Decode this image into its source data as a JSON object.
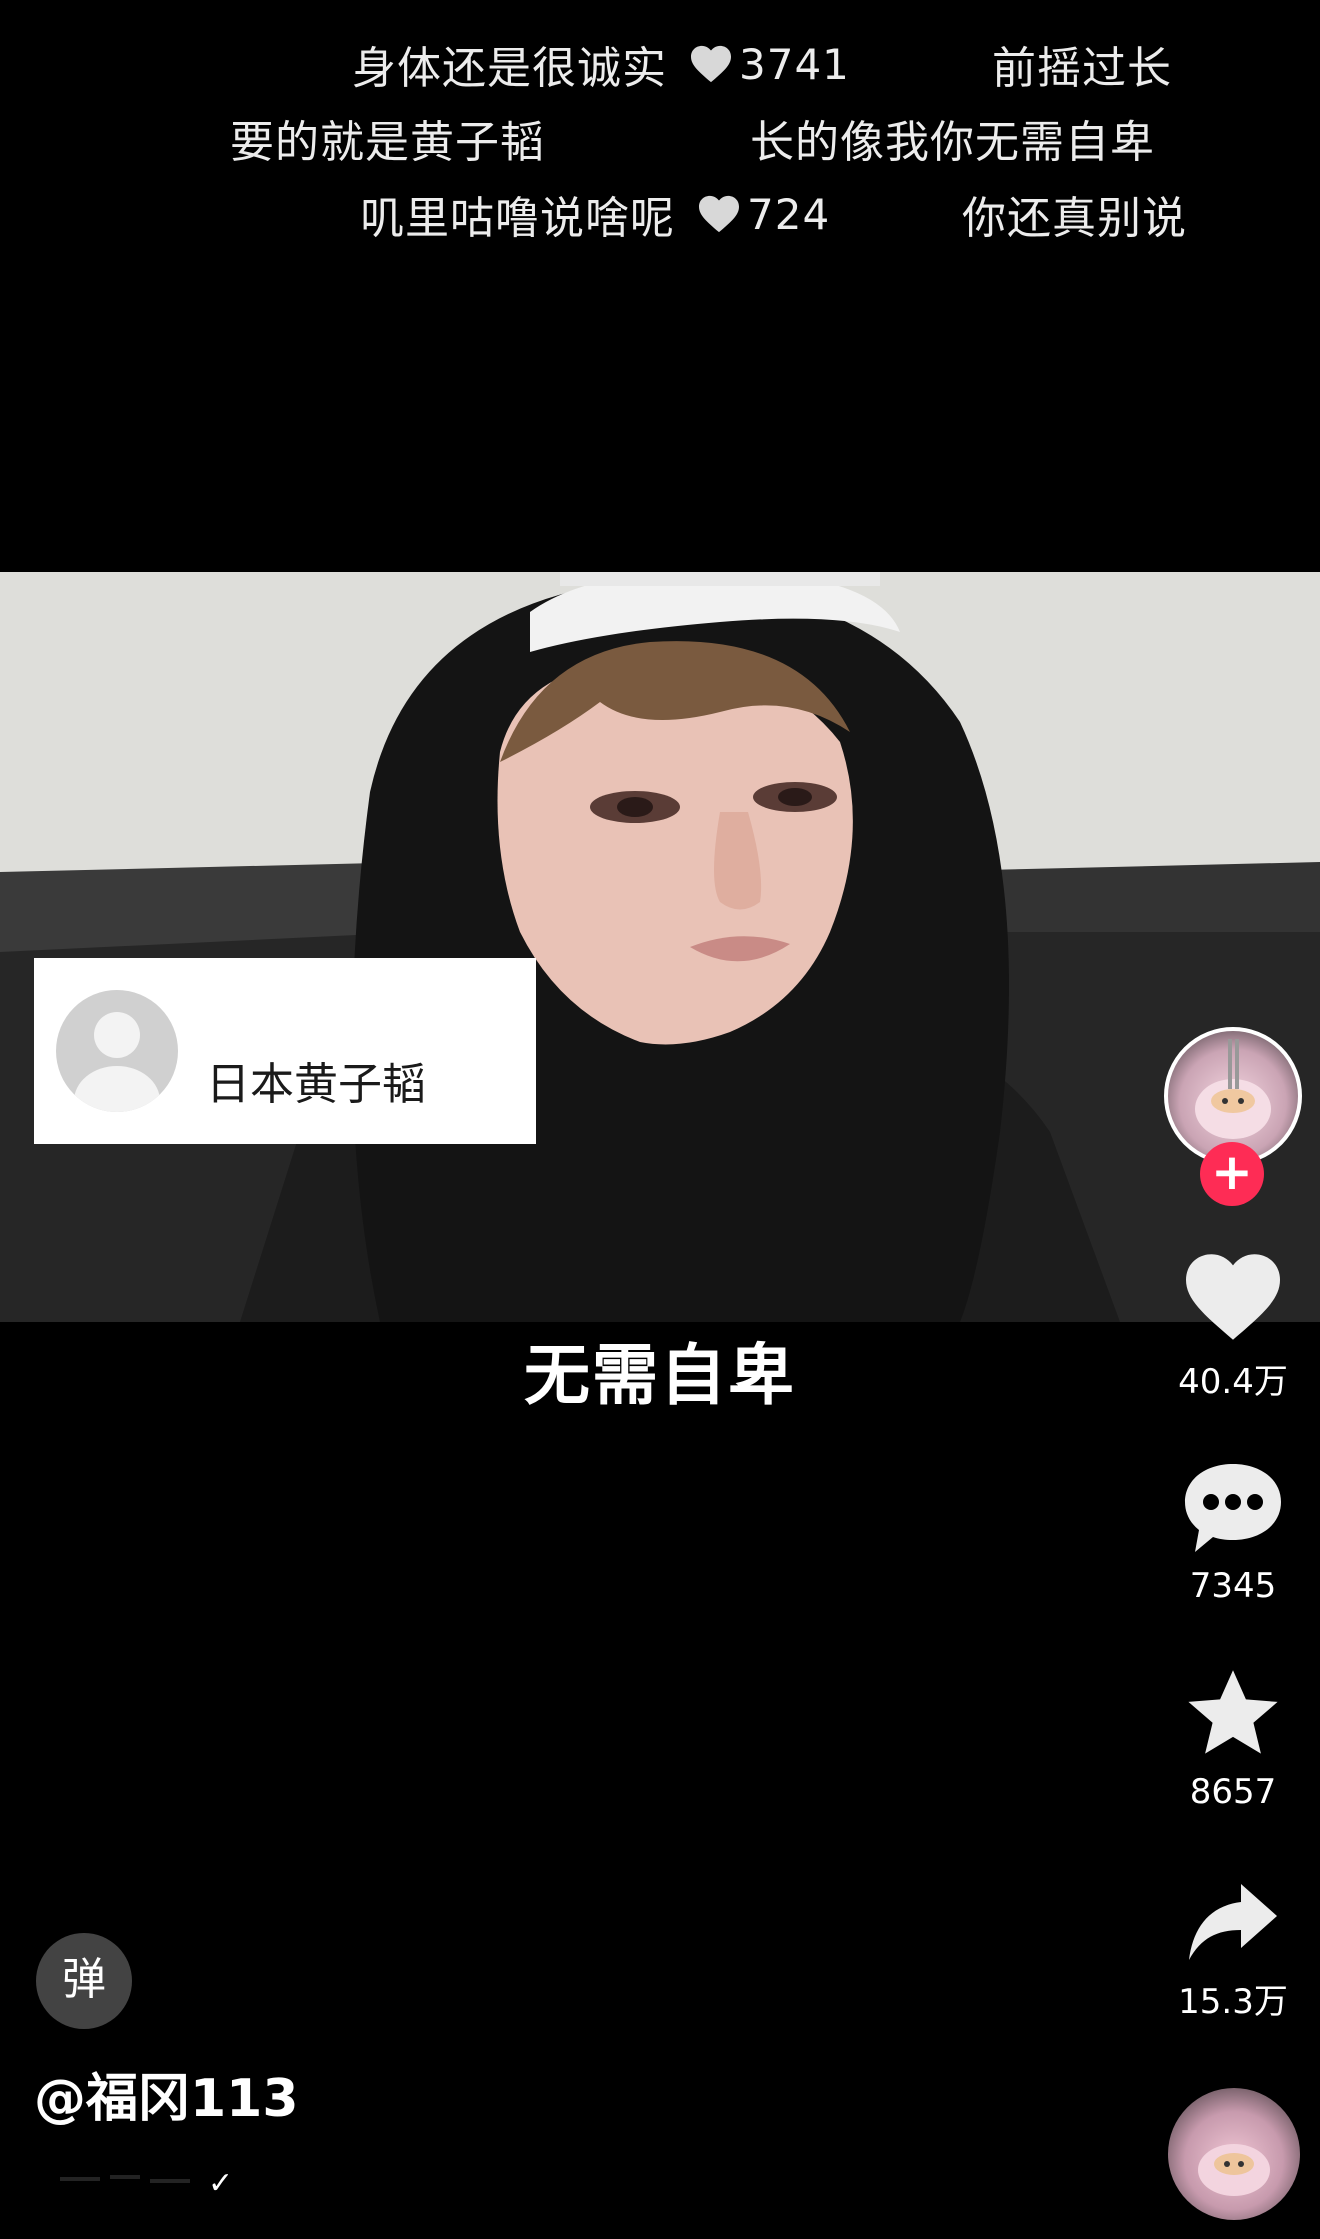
{
  "danmaku": [
    {
      "text": "身体还是很诚实",
      "likes": "3741"
    },
    {
      "text": "前摇过长"
    },
    {
      "text": "要的就是黄子韬"
    },
    {
      "text": "长的像我你无需自卑"
    },
    {
      "text": "叽里咕噜说啥呢",
      "likes": "724"
    },
    {
      "text": "你还真别说"
    }
  ],
  "video": {
    "comment_card_name": "日本黄子韬",
    "caption": "无需自卑"
  },
  "actions": {
    "follow_symbol": "+",
    "like_count": "40.4万",
    "comment_count": "7345",
    "favorite_count": "8657",
    "share_count": "15.3万"
  },
  "bottom": {
    "danmaku_toggle_label": "弹",
    "author": "@福冈113"
  },
  "colors": {
    "background": "#000000",
    "follow_accent": "#fe2c55",
    "text": "#ffffff"
  },
  "icons": [
    "heart-icon",
    "comment-icon",
    "star-icon",
    "share-icon",
    "music-disc-icon",
    "plus-icon"
  ]
}
